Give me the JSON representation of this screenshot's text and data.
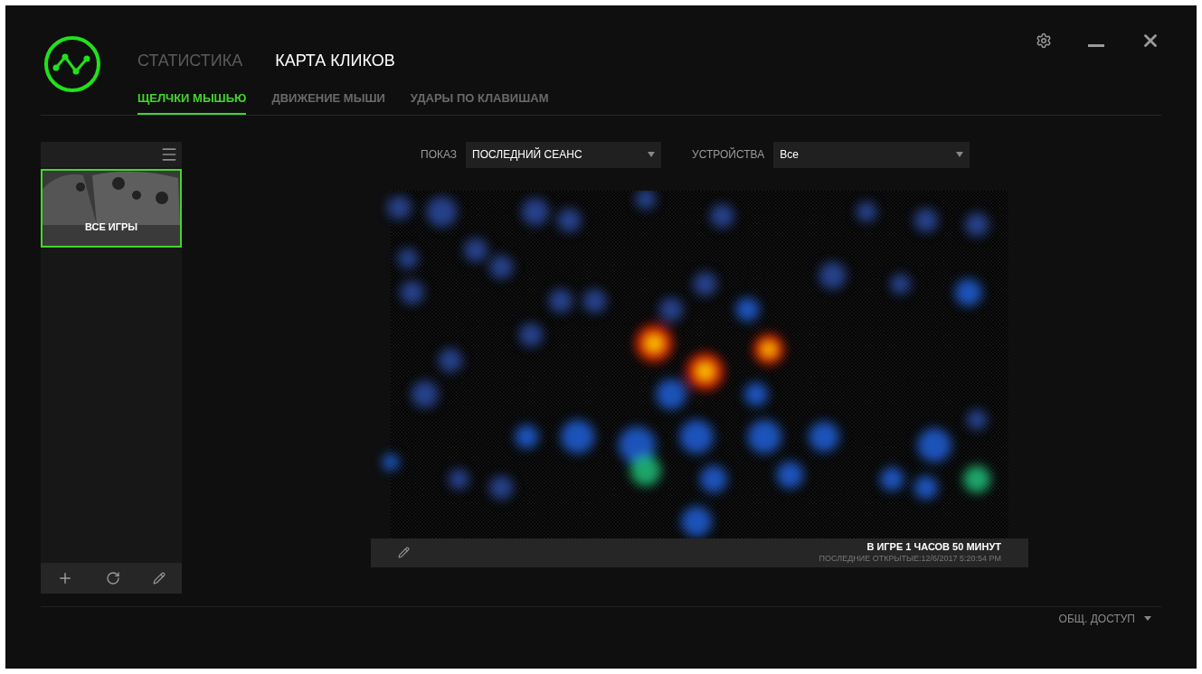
{
  "main_tabs": [
    {
      "label": "СТАТИСТИКА",
      "selected": false
    },
    {
      "label": "КАРТА КЛИКОВ",
      "selected": true
    }
  ],
  "sub_tabs": [
    {
      "label": "ЩЕЛЧКИ МЫШЬЮ",
      "selected": true
    },
    {
      "label": "ДВИЖЕНИЕ МЫШИ",
      "selected": false
    },
    {
      "label": "УДАРЫ ПО КЛАВИШАМ",
      "selected": false
    }
  ],
  "games": [
    {
      "label": "ВСЕ ИГРЫ",
      "selected": true
    }
  ],
  "filters": [
    {
      "label": "ПОКАЗ",
      "value": "ПОСЛЕДНИЙ СЕАНС"
    },
    {
      "label": "УСТРОЙСТВА",
      "value": "Все"
    }
  ],
  "heatmap": {
    "playtime": "В ИГРЕ 1 ЧАСОВ 50 МИНУТ",
    "last_opened": "ПОСЛЕДНИЕ ОТКРЫТЫЕ:12/6/2017 5:20:54 PM"
  },
  "share": "ОБЩ. ДОСТУП"
}
